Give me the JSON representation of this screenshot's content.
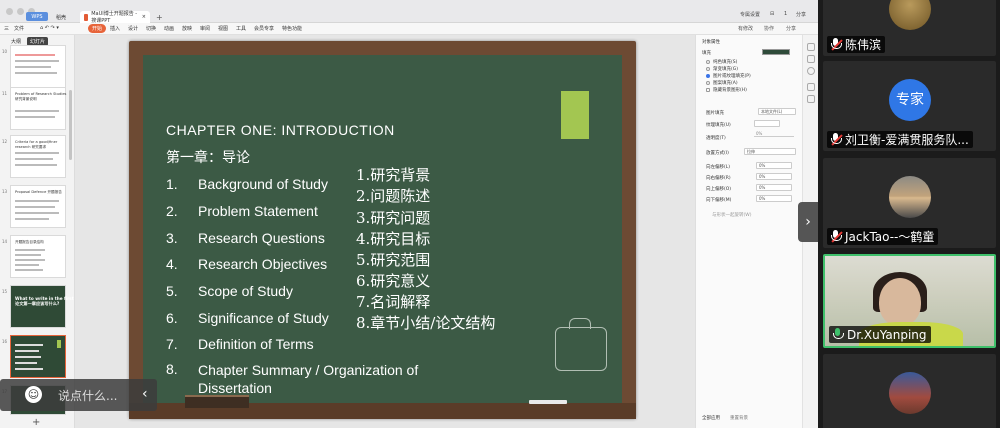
{
  "titlebar": {
    "wps_label": "WPS",
    "home_label": "稻壳",
    "doc_tab": "MaUI博士开题报告 - 搜课PPT",
    "doc_close": "×",
    "add_tab": "+",
    "right_items": [
      "专属设置",
      "⊟",
      "1",
      "分享"
    ]
  },
  "ribbon": {
    "items": [
      "三",
      "文件",
      "开始",
      "插入",
      "设计",
      "切换",
      "动画",
      "放映",
      "审阅",
      "视图",
      "工具",
      "会员专享",
      "特色功能"
    ],
    "active": "开始",
    "right_items": [
      "有修改",
      "协作",
      "分享"
    ]
  },
  "thumbs": {
    "tabs": [
      "大纲",
      "幻灯片"
    ],
    "slides": [
      {
        "num": "10",
        "title": ""
      },
      {
        "num": "11",
        "title": "Problem of Research Studies\n研究背景说明"
      },
      {
        "num": "12",
        "title": "Criteria for a good/finer research 研究要求"
      },
      {
        "num": "13",
        "title": "Proposal Defence 开题报告"
      },
      {
        "num": "14",
        "title": "开题报告目录结构"
      },
      {
        "num": "15",
        "title": "What to write in the first chapter?\n论文第一章应该写什么?"
      },
      {
        "num": "16",
        "title": ""
      },
      {
        "num": "17",
        "title": ""
      }
    ],
    "add": "+"
  },
  "slide": {
    "title": "CHAPTER ONE: INTRODUCTION",
    "subtitle": "第一章：导论",
    "items": [
      {
        "num": "1.",
        "text": "Background of Study"
      },
      {
        "num": "2.",
        "text": "Problem Statement"
      },
      {
        "num": "3.",
        "text": "Research Questions"
      },
      {
        "num": "4.",
        "text": "Research Objectives"
      },
      {
        "num": "5.",
        "text": "Scope of Study"
      },
      {
        "num": "6.",
        "text": "Significance of Study"
      },
      {
        "num": "7.",
        "text": "Definition of Terms"
      },
      {
        "num": "8.",
        "text": "Chapter Summary / Organization of Dissertation"
      }
    ],
    "zh_items": [
      "1.研究背景",
      "2.问题陈述",
      "3.研究问题",
      "4.研究目标",
      "5.研究范围",
      "6.研究意义",
      "7.名词解释",
      "8.章节小结/论文结构"
    ]
  },
  "chat": {
    "placeholder": "说点什么...",
    "face_icon": "☺",
    "arrow": "‹"
  },
  "props": {
    "title": "对象属性",
    "section_fill": "填充",
    "fill_options": [
      "纯色填充(S)",
      "渐变填充(G)",
      "图片或纹理填充(P)",
      "图案填充(A)",
      "隐藏背景图形(H)"
    ],
    "selected_fill": "图片或纹理填充(P)",
    "image_fill_label": "图片填充",
    "image_fill_value": "本地文件(L)",
    "texture_label": "纹理填充(U)",
    "transparency_label": "透明度(T)",
    "transparency_value": "0%",
    "tile_label": "放置方式(I)",
    "tile_value": "拉伸",
    "offsets": [
      {
        "label": "向左偏移(L)",
        "value": "0%"
      },
      {
        "label": "向右偏移(R)",
        "value": "0%"
      },
      {
        "label": "向上偏移(O)",
        "value": "0%"
      },
      {
        "label": "向下偏移(M)",
        "value": "0%"
      }
    ],
    "link_label": "与形状一起旋转(W)",
    "footer": [
      "全部应用",
      "重置背景"
    ],
    "swatch_color": "#2e4a39"
  },
  "collapse_arrow": "›",
  "participants": [
    {
      "name": "陈伟滨",
      "mic": "muted",
      "avatar": "gold",
      "active": false
    },
    {
      "name": "刘卫衡-爱满贯服务队...",
      "mic": "muted",
      "avatar": "blue",
      "avatar_text": "专家",
      "active": false
    },
    {
      "name": "JackTao--～鹤童",
      "mic": "muted",
      "avatar": "sunset",
      "active": false
    },
    {
      "name": "Dr.XuYanping",
      "mic": "live",
      "avatar": "video",
      "active": true
    },
    {
      "name": "",
      "mic": "",
      "avatar": "palace",
      "active": false
    }
  ],
  "colors": {
    "accent": "#e7643a",
    "board": "#3c5a45",
    "frame": "#6d4a33",
    "active_speaker": "#3fc06b"
  }
}
